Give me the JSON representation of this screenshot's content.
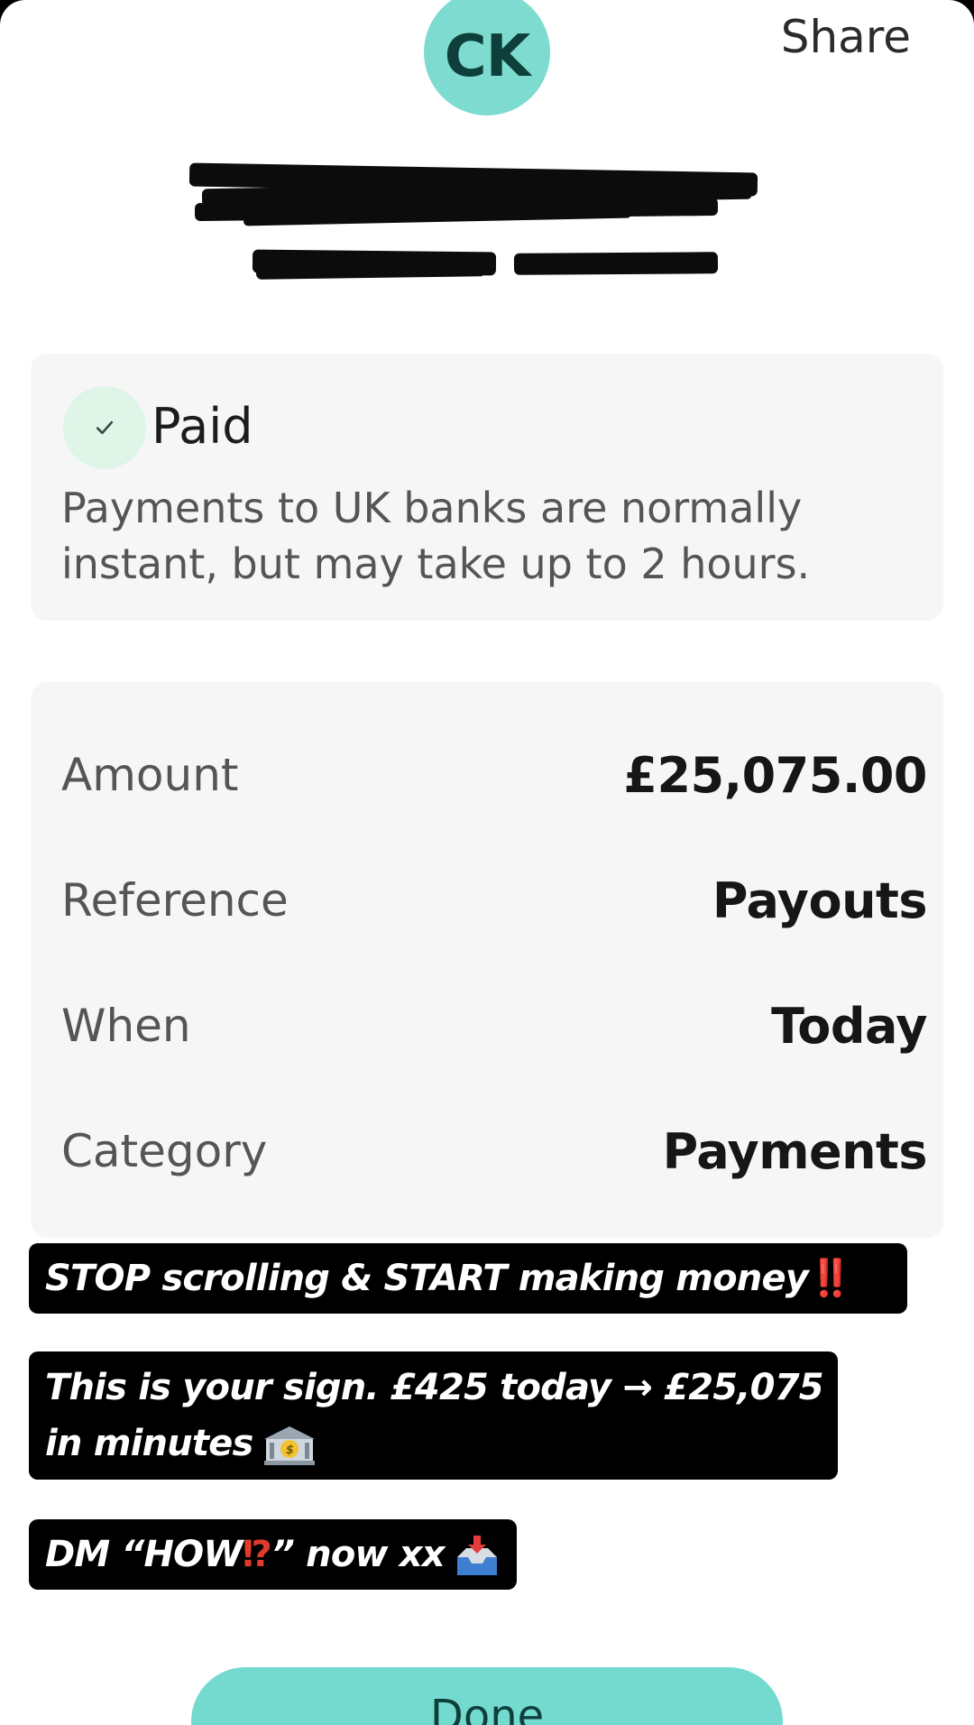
{
  "header": {
    "avatar_initials": "CK",
    "share_label": "Share"
  },
  "status": {
    "title": "Paid",
    "note": "Payments to UK banks are normally instant, but may take up to 2 hours."
  },
  "details": [
    {
      "label": "Amount",
      "value": "£25,075.00"
    },
    {
      "label": "Reference",
      "value": "Payouts"
    },
    {
      "label": "When",
      "value": "Today"
    },
    {
      "label": "Category",
      "value": "Payments"
    }
  ],
  "captions": {
    "line1": "STOP scrolling & START making money",
    "line1_mark": "‼️",
    "line2a": "This is your sign. £425 today → £25,075",
    "line2b": "in minutes",
    "line3_pre": "DM “HOW",
    "line3_mark": "⁉",
    "line3_post": "” now xx"
  },
  "done_label": "Done",
  "colors": {
    "accent": "#74dad0",
    "avatar_bg": "#7ddccf",
    "card_bg": "#f6f6f6",
    "check_bg": "#dff5e8",
    "alert_red": "#e23a2b"
  }
}
